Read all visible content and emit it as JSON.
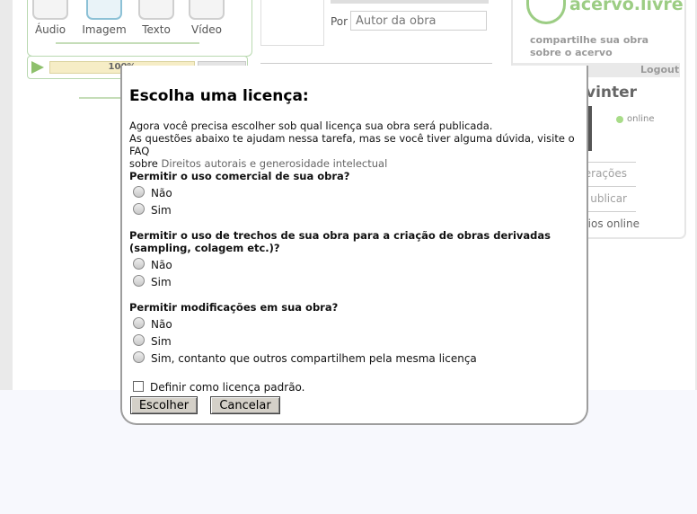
{
  "page": {
    "media_tabs": [
      "Áudio",
      "Imagem",
      "Texto",
      "Vídeo"
    ],
    "progress_label": "100%",
    "by_label": "Por",
    "author_placeholder": "Autor da obra",
    "logo_text": "acervo.livre",
    "share_text": "compartilhe sua obra sobre o acervo",
    "logout": "Logout",
    "username": "vinter",
    "online": "online",
    "right_links": [
      "erações",
      "ublicar"
    ],
    "online_users": "rios online"
  },
  "modal": {
    "title": "Escolha uma licença:",
    "intro_1": "Agora você precisa escolher sob qual licença sua obra será publicada.",
    "intro_2": "As questões abaixo te ajudam nessa tarefa, mas se você tiver alguma dúvida, visite o FAQ",
    "intro_3_prefix": "sobre",
    "intro_link": "Direitos autorais e generosidade intelectual",
    "q1": "Permitir o uso comercial de sua obra?",
    "q1_options": [
      "Não",
      "Sim"
    ],
    "q2": "Permitir o uso de trechos de sua obra para a criação de obras derivadas (sampling, colagem etc.)?",
    "q2_options": [
      "Não",
      "Sim"
    ],
    "q3": "Permitir modificações em sua obra?",
    "q3_options": [
      "Não",
      "Sim",
      "Sim, contanto que outros compartilhem pela mesma licença"
    ],
    "default_checkbox": "Definir como licença padrão.",
    "choose_button": "Escolher",
    "cancel_button": "Cancelar"
  }
}
